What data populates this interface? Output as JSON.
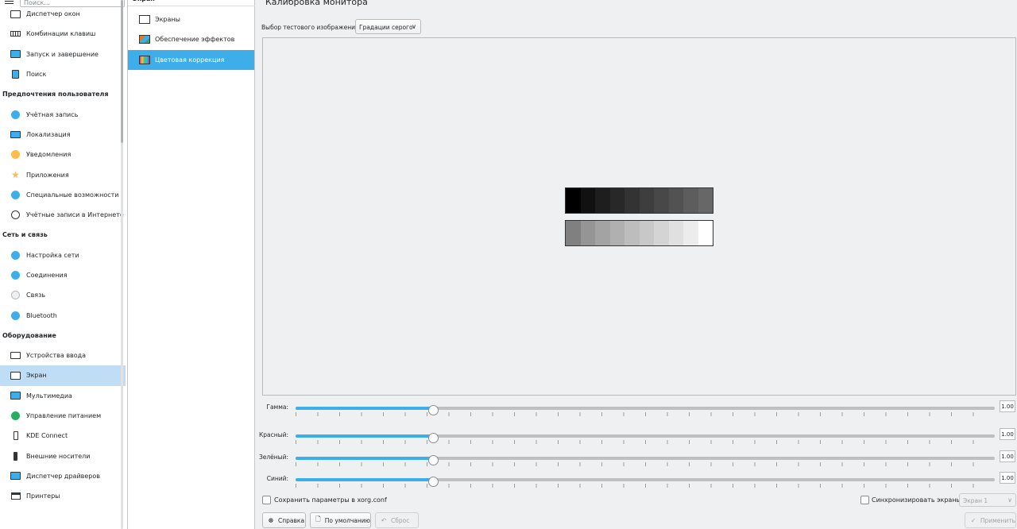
{
  "search": {
    "placeholder": "Поиск..."
  },
  "sidebar": {
    "items": [
      {
        "type": "item",
        "label": "Диспетчер окон",
        "icon": "window-manager-icon"
      },
      {
        "type": "item",
        "label": "Комбинации клавиш",
        "icon": "keyboard-icon"
      },
      {
        "type": "item",
        "label": "Запуск и завершение",
        "icon": "startup-icon"
      },
      {
        "type": "item",
        "label": "Поиск",
        "icon": "search-icon"
      },
      {
        "type": "category",
        "label": "Предпочтения пользователя"
      },
      {
        "type": "item",
        "label": "Учётная запись",
        "icon": "user-account-icon"
      },
      {
        "type": "item",
        "label": "Локализация",
        "icon": "localization-icon"
      },
      {
        "type": "item",
        "label": "Уведомления",
        "icon": "notifications-icon"
      },
      {
        "type": "item",
        "label": "Приложения",
        "icon": "star-icon"
      },
      {
        "type": "item",
        "label": "Специальные возможности",
        "icon": "accessibility-icon"
      },
      {
        "type": "item",
        "label": "Учётные записи в Интернете",
        "icon": "globe-icon"
      },
      {
        "type": "category",
        "label": "Сеть и связь"
      },
      {
        "type": "item",
        "label": "Настройка сети",
        "icon": "network-settings-icon"
      },
      {
        "type": "item",
        "label": "Соединения",
        "icon": "connections-icon"
      },
      {
        "type": "item",
        "label": "Связь",
        "icon": "share-icon"
      },
      {
        "type": "item",
        "label": "Bluetooth",
        "icon": "bluetooth-icon"
      },
      {
        "type": "category",
        "label": "Оборудование"
      },
      {
        "type": "item",
        "label": "Устройства ввода",
        "icon": "input-devices-icon"
      },
      {
        "type": "item",
        "label": "Экран",
        "icon": "display-icon",
        "selected": true
      },
      {
        "type": "item",
        "label": "Мультимедиа",
        "icon": "multimedia-icon"
      },
      {
        "type": "item",
        "label": "Управление питанием",
        "icon": "power-icon"
      },
      {
        "type": "item",
        "label": "KDE Connect",
        "icon": "phone-icon"
      },
      {
        "type": "item",
        "label": "Внешние носители",
        "icon": "usb-icon"
      },
      {
        "type": "item",
        "label": "Диспетчер драйверов",
        "icon": "drivers-icon"
      },
      {
        "type": "item",
        "label": "Принтеры",
        "icon": "printer-icon"
      }
    ]
  },
  "midpanel": {
    "header": "Экран",
    "items": [
      {
        "label": "Экраны",
        "icon": "screen-icon"
      },
      {
        "label": "Обеспечение эффектов",
        "icon": "effects-icon"
      },
      {
        "label": "Цветовая коррекция",
        "icon": "color-correction-icon",
        "selected": true
      }
    ]
  },
  "main": {
    "title": "Калибровка монитора",
    "test_image_label": "Выбор тестового изображения:",
    "test_image_value": "Градации серого",
    "sliders": [
      {
        "label": "Гамма:",
        "value": "1.00",
        "fraction": 0.197
      },
      {
        "label": "Красный:",
        "value": "1.00",
        "fraction": 0.197
      },
      {
        "label": "Зелёный:",
        "value": "1.00",
        "fraction": 0.197
      },
      {
        "label": "Синий:",
        "value": "1.00",
        "fraction": 0.197
      }
    ],
    "save_xorg_label": "Сохранить параметры в xorg.conf",
    "sync_screens_label": "Синхронизировать экраны",
    "screen_select_value": "Экран 1"
  },
  "gradient": {
    "dark_row": [
      "#000000",
      "#111111",
      "#1e1e1e",
      "#282828",
      "#333333",
      "#3e3e3e",
      "#484848",
      "#525252",
      "#5d5d5d",
      "#676767"
    ],
    "light_row": [
      "#808080",
      "#959595",
      "#a3a3a3",
      "#b0b0b0",
      "#bdbdbd",
      "#c8c8c8",
      "#d4d4d4",
      "#e0e0e0",
      "#ececec",
      "#ffffff"
    ]
  },
  "buttons": {
    "help": "Справка",
    "defaults": "По умолчанию",
    "reset": "Сброс",
    "apply": "Применить"
  },
  "colors": {
    "accent": "#3daee9",
    "selection_light": "#bfddf4",
    "window_bg": "#eff0f1"
  }
}
